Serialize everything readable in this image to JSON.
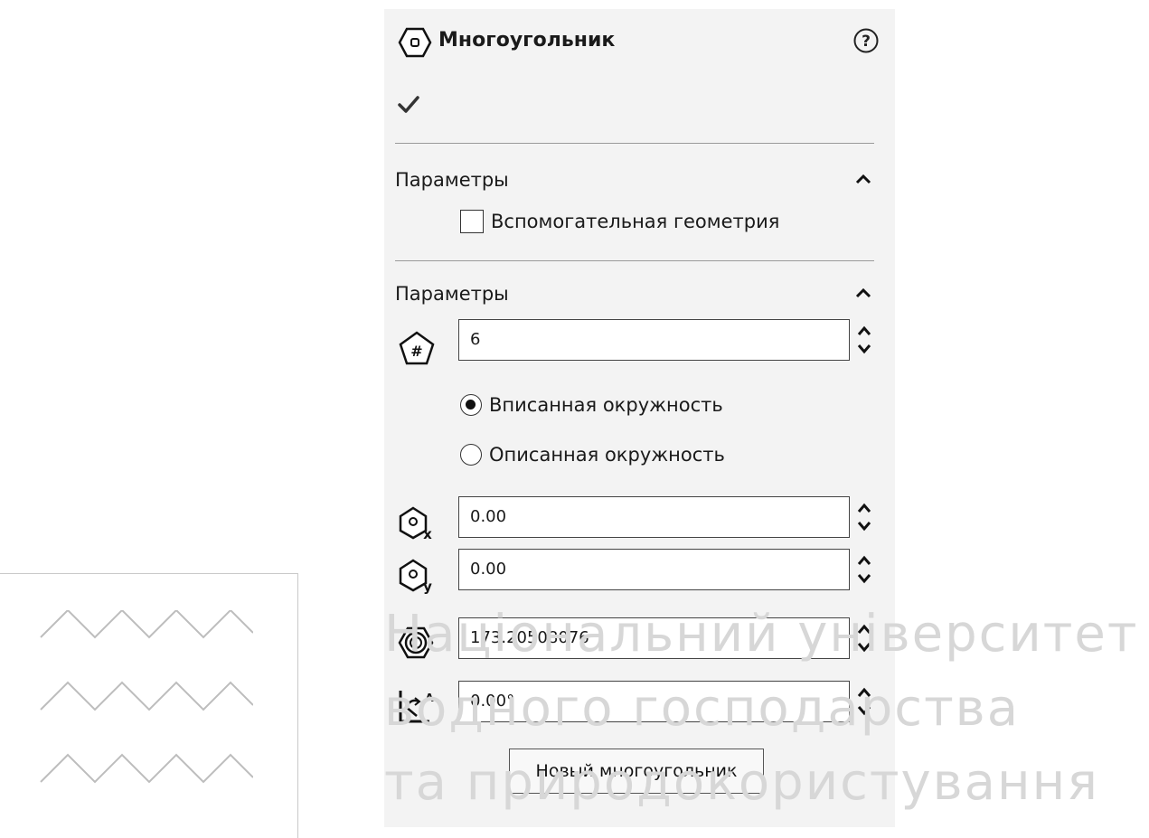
{
  "panel": {
    "title": "Многоугольник",
    "icons": {
      "header": "polygon-icon",
      "help": "help-icon",
      "ok": "checkmark-icon"
    }
  },
  "sections": [
    {
      "title": "Параметры",
      "collapse_icon": "chevron-up-icon",
      "checkbox": {
        "label": "Вспомогательная геометрия",
        "checked": false
      }
    },
    {
      "title": "Параметры",
      "collapse_icon": "chevron-up-icon",
      "sides": {
        "value": "6",
        "icon": "polygon-sides-icon"
      },
      "radios": [
        {
          "label": "Вписанная окружность",
          "selected": true
        },
        {
          "label": "Описанная окружность",
          "selected": false
        }
      ],
      "center_x": {
        "value": "0.00",
        "icon": "center-x-icon"
      },
      "center_y": {
        "value": "0.00",
        "icon": "center-y-icon"
      },
      "diameter": {
        "value": "173.20508076",
        "icon": "circle-diameter-icon"
      },
      "angle": {
        "value": "0.00°",
        "icon": "angle-icon"
      },
      "new_button": "Новый многоугольник"
    }
  ],
  "watermark": {
    "line1": "Національний університет",
    "line2": "водного господарства",
    "line3": "та природокористування"
  }
}
